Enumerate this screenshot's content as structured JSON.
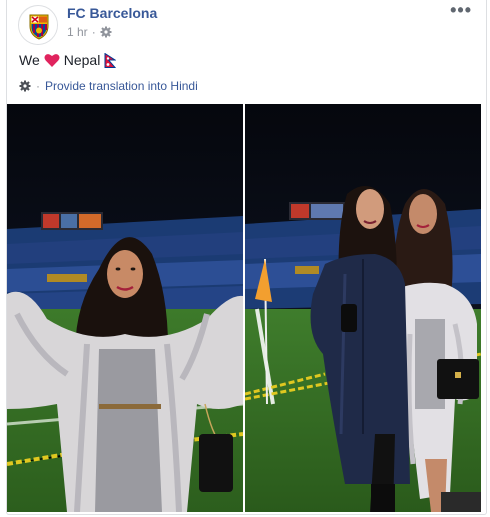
{
  "post": {
    "page_name": "FC Barcelona",
    "timestamp": "1 hr",
    "dot": "·",
    "privacy_icon": "gear-icon",
    "options_label": "•••",
    "message": {
      "before": "We",
      "heart_icon": "red-heart-emoji",
      "after": "Nepal",
      "flag_icon": "nepal-flag-emoji"
    },
    "translation": {
      "settings_icon": "gear-icon",
      "separator": "·",
      "link_text": "Provide translation into Hindi"
    }
  },
  "photos": [
    {
      "name": "stadium-photo-single-woman"
    },
    {
      "name": "stadium-photo-two-women"
    }
  ],
  "colors": {
    "link_blue": "#385898",
    "meta_gray": "#90949c",
    "heart_red": "#e0245e",
    "flag_crimson": "#dc143c",
    "flag_blue": "#003893",
    "barca_blue": "#004d98",
    "barca_red": "#a50044"
  }
}
